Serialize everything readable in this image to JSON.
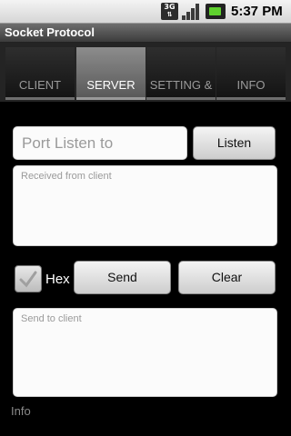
{
  "status_bar": {
    "network": "3G",
    "time": "5:37 PM",
    "icons": [
      "3g-icon",
      "signal-icon",
      "battery-icon"
    ]
  },
  "app": {
    "title": "Socket Protocol"
  },
  "tabs": [
    {
      "label": "CLIENT",
      "selected": false
    },
    {
      "label": "SERVER",
      "selected": true
    },
    {
      "label": "SETTING &",
      "selected": false
    },
    {
      "label": "INFO",
      "selected": false
    }
  ],
  "server": {
    "port_placeholder": "Port Listen to",
    "listen_label": "Listen",
    "received_placeholder": "Received from client",
    "hex_label": "Hex",
    "hex_checked": false,
    "send_label": "Send",
    "clear_label": "Clear",
    "send_placeholder": "Send to client",
    "info_label": "Info"
  }
}
